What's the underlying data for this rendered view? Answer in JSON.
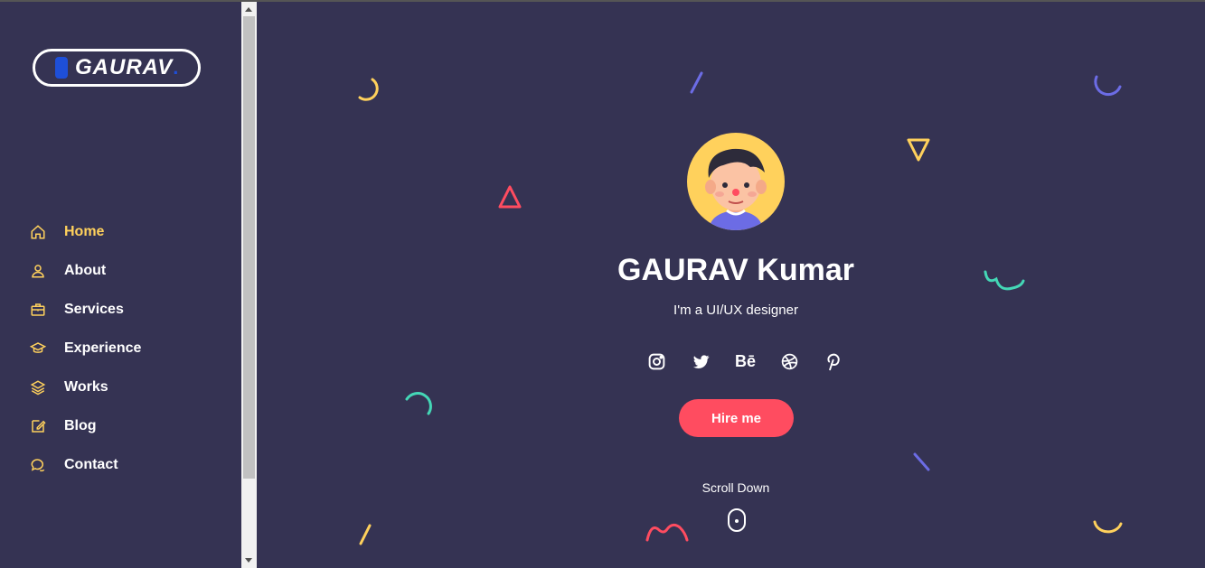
{
  "logo": {
    "text": "GAURAV",
    "dot": "."
  },
  "nav": [
    {
      "label": "Home",
      "icon": "home-icon",
      "active": true
    },
    {
      "label": "About",
      "icon": "user-icon"
    },
    {
      "label": "Services",
      "icon": "briefcase-icon"
    },
    {
      "label": "Experience",
      "icon": "graduation-cap-icon"
    },
    {
      "label": "Works",
      "icon": "layers-icon"
    },
    {
      "label": "Blog",
      "icon": "edit-icon"
    },
    {
      "label": "Contact",
      "icon": "chat-icon"
    }
  ],
  "hero": {
    "name": "GAURAV Kumar",
    "tagline": "I'm a UI/UX designer",
    "socials": [
      "instagram-icon",
      "twitter-icon",
      "behance-icon",
      "dribbble-icon",
      "pinterest-icon"
    ],
    "behance_text": "Bē",
    "hire_label": "Hire me",
    "scroll_label": "Scroll Down"
  },
  "colors": {
    "background": "#353353",
    "accent": "#ffd15c",
    "button": "#ff4c60"
  }
}
